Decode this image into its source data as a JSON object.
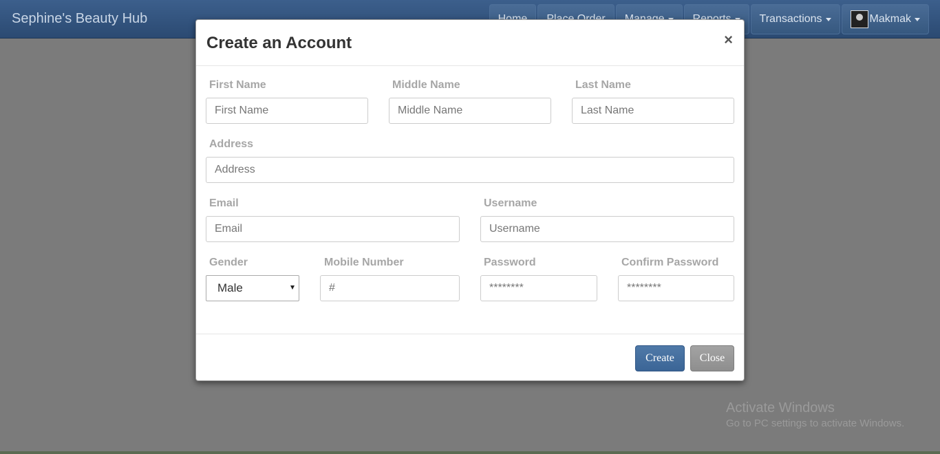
{
  "navbar": {
    "brand": "Sephine's Beauty Hub",
    "items": [
      {
        "label": "Home"
      },
      {
        "label": "Place Order"
      },
      {
        "label": "Manage"
      },
      {
        "label": "Reports"
      },
      {
        "label": "Transactions"
      }
    ],
    "user": "Makmak"
  },
  "modal": {
    "title": "Create an Account",
    "close_symbol": "×",
    "fields": {
      "first_name": {
        "label": "First Name",
        "placeholder": "First Name"
      },
      "middle_name": {
        "label": "Middle Name",
        "placeholder": "Middle Name"
      },
      "last_name": {
        "label": "Last Name",
        "placeholder": "Last Name"
      },
      "address": {
        "label": "Address",
        "placeholder": "Address"
      },
      "email": {
        "label": "Email",
        "placeholder": "Email"
      },
      "username": {
        "label": "Username",
        "placeholder": "Username"
      },
      "gender": {
        "label": "Gender",
        "value": "Male"
      },
      "mobile": {
        "label": "Mobile Number",
        "placeholder": "#"
      },
      "password": {
        "label": "Password",
        "placeholder": "********"
      },
      "confirm_password": {
        "label": "Confirm Password",
        "placeholder": "********"
      }
    },
    "buttons": {
      "create": "Create",
      "close": "Close"
    }
  },
  "watermark": {
    "title": "Activate Windows",
    "subtitle": "Go to PC settings to activate Windows."
  },
  "colors": {
    "navbar": "#2b4a72",
    "primary_button": "#3b6596",
    "overlay": "#7b7b7b"
  }
}
